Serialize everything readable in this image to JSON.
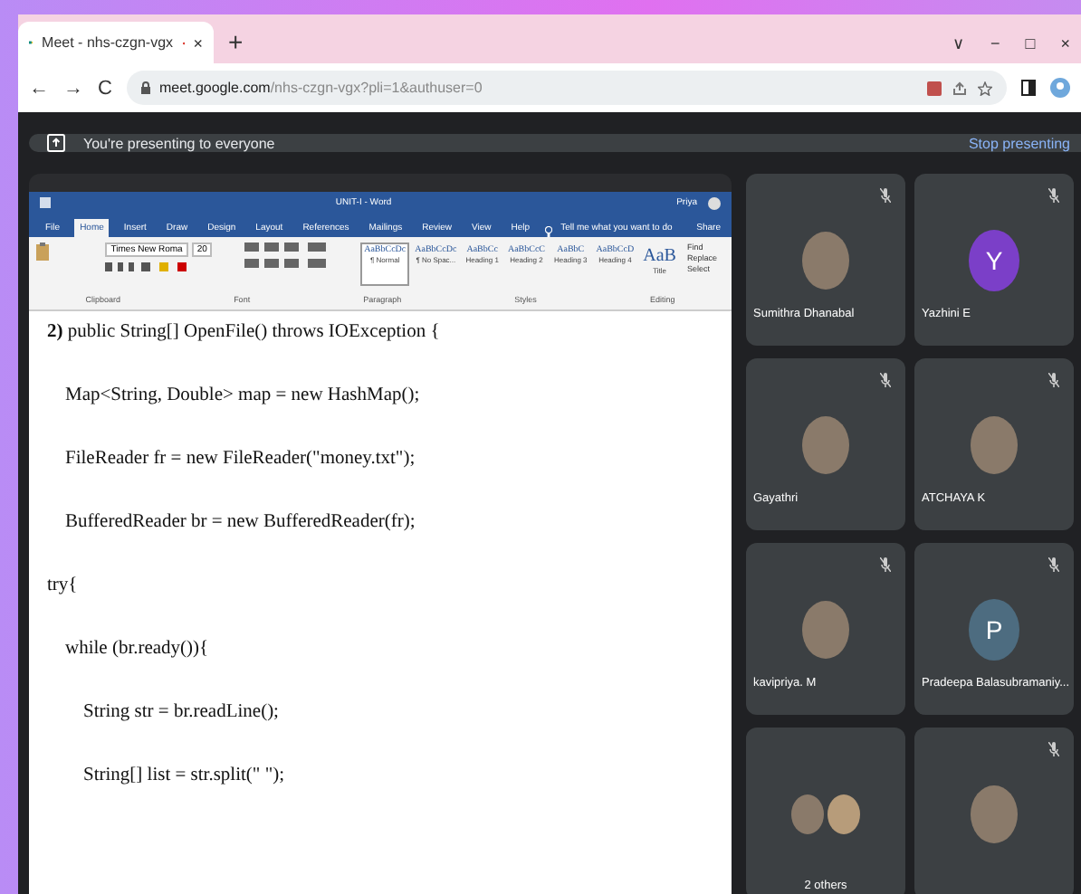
{
  "browser": {
    "tab": {
      "title": "Meet - nhs-czgn-vgx",
      "close": "×"
    },
    "new_tab": "+",
    "window_controls": [
      "∨",
      "−",
      "□",
      "×"
    ],
    "nav_buttons": [
      "←",
      "→",
      "C"
    ],
    "url_host": "meet.google.com",
    "url_path": "/nhs-czgn-vgx?pli=1&authuser=0"
  },
  "banner": {
    "text": "You're presenting to everyone",
    "action": "Stop presenting"
  },
  "word": {
    "title": "UNIT-I - Word",
    "user": "Priya",
    "tabs": [
      {
        "label": "File",
        "selected": false
      },
      {
        "label": "Home",
        "selected": true
      },
      {
        "label": "Insert",
        "selected": false
      },
      {
        "label": "Draw",
        "selected": false
      },
      {
        "label": "Design",
        "selected": false
      },
      {
        "label": "Layout",
        "selected": false
      },
      {
        "label": "References",
        "selected": false
      },
      {
        "label": "Mailings",
        "selected": false
      },
      {
        "label": "Review",
        "selected": false
      },
      {
        "label": "View",
        "selected": false
      },
      {
        "label": "Help",
        "selected": false
      }
    ],
    "tell_me": "Tell me what you want to do",
    "share": "Share",
    "font_name": "Times New Roma",
    "font_size": "20",
    "styles": [
      {
        "sample": "AaBbCcDc",
        "label": "¶ Normal",
        "selected": true
      },
      {
        "sample": "AaBbCcDc",
        "label": "¶ No Spac...",
        "selected": false
      },
      {
        "sample": "AaBbCc",
        "label": "Heading 1",
        "selected": false
      },
      {
        "sample": "AaBbCcC",
        "label": "Heading 2",
        "selected": false
      },
      {
        "sample": "AaBbC",
        "label": "Heading 3",
        "selected": false
      },
      {
        "sample": "AaBbCcD",
        "label": "Heading 4",
        "selected": false
      },
      {
        "sample": "AaB",
        "label": "Title",
        "selected": false
      }
    ],
    "editing": [
      "Find",
      "Replace",
      "Select"
    ],
    "groups": [
      "Clipboard",
      "Font",
      "Paragraph",
      "Styles",
      "Editing"
    ],
    "lines": [
      {
        "text": "**2)** public String[] OpenFile() throws IOException {",
        "children": [
          {
            "text": "Map<String, Double> map = new HashMap();"
          },
          {
            "text": "FileReader fr = new FileReader(\"money.txt\");"
          },
          {
            "text": "BufferedReader br = new BufferedReader(fr);"
          }
        ]
      },
      {
        "text": "try{",
        "children": [
          {
            "text": "while (br.ready()){",
            "children": [
              {
                "text": "String str = br.readLine();"
              },
              {
                "text": "String[] list = str.split(\" \");"
              }
            ]
          }
        ]
      }
    ]
  },
  "participants": [
    {
      "name": "Sumithra Dhanabal",
      "kind": "photo",
      "muted": true
    },
    {
      "name": "Yazhini E",
      "kind": "letter",
      "letter": "Y",
      "color": "#7b3fc8",
      "muted": true
    },
    {
      "name": "Gayathri",
      "kind": "photo",
      "muted": true
    },
    {
      "name": "ATCHAYA K",
      "kind": "photo",
      "muted": true
    },
    {
      "name": "kavipriya. M",
      "kind": "photo",
      "muted": true
    },
    {
      "name": "Pradeepa Balasubramaniy...",
      "kind": "letter",
      "letter": "P",
      "color": "#4d6c80",
      "muted": true
    },
    {
      "name": "2 others",
      "kind": "pair",
      "muted": false
    },
    {
      "kind": "photo",
      "muted": true
    }
  ]
}
